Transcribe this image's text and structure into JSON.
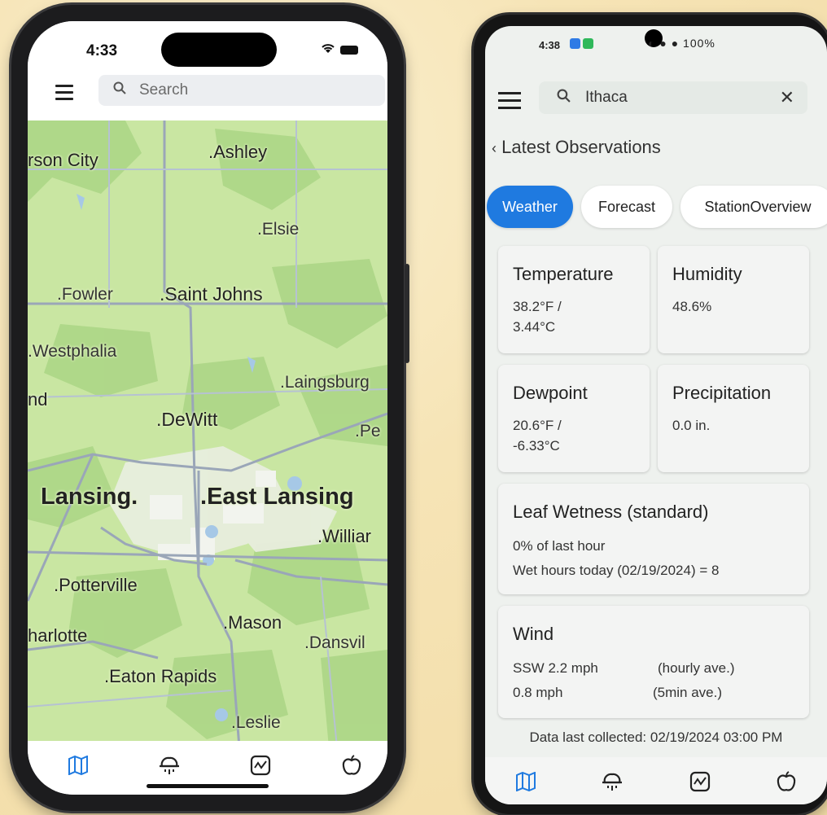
{
  "iphone": {
    "status_time": "4:33",
    "search": {
      "placeholder": "Search"
    },
    "map_labels": {
      "carson_city": "rson City",
      "ashley": "Ashley",
      "elsie": "Elsie",
      "fowler": "Fowler",
      "saint_johns": "Saint Johns",
      "westphalia": "Westphalia",
      "laingsburg": "Laingsburg",
      "nd": "nd",
      "dewitt": "DeWitt",
      "pe": "Pe",
      "lansing": "Lansing",
      "east_lansing": "East Lansing",
      "williamston": "Williar",
      "potterville": "Potterville",
      "mason": "Mason",
      "charlotte": "harlotte",
      "dansville": "Dansvil",
      "eaton_rapids": "Eaton Rapids",
      "leslie": "Leslie"
    },
    "tabs": [
      "map-icon",
      "weather-icon",
      "chart-icon",
      "apple-icon"
    ],
    "accent": "#1f7ae0"
  },
  "android": {
    "status_time": "4:38",
    "status_battery": "100%",
    "search": {
      "value": "Ithaca"
    },
    "section_title": "Latest Observations",
    "chips": [
      "Weather",
      "Forecast",
      "StationOverview"
    ],
    "cards": {
      "temperature": {
        "title": "Temperature",
        "line1": "38.2°F /",
        "line2": "3.44°C"
      },
      "humidity": {
        "title": "Humidity",
        "line1": "48.6%"
      },
      "dewpoint": {
        "title": "Dewpoint",
        "line1": "20.6°F /",
        "line2": "-6.33°C"
      },
      "precipitation": {
        "title": "Precipitation",
        "line1": "0.0 in."
      },
      "leaf": {
        "title": "Leaf Wetness (standard)",
        "line1": "0% of last hour",
        "line2": "Wet hours today (02/19/2024) = 8"
      },
      "wind": {
        "title": "Wind",
        "speed1": "SSW 2.2 mph",
        "note1": "(hourly ave.)",
        "speed2": "0.8 mph",
        "note2": "(5min ave.)"
      }
    },
    "footer": "Data last collected: 02/19/2024 03:00 PM",
    "tabs": [
      "map-icon",
      "weather-icon",
      "chart-icon",
      "apple-icon"
    ],
    "accent": "#1f7ae0"
  }
}
